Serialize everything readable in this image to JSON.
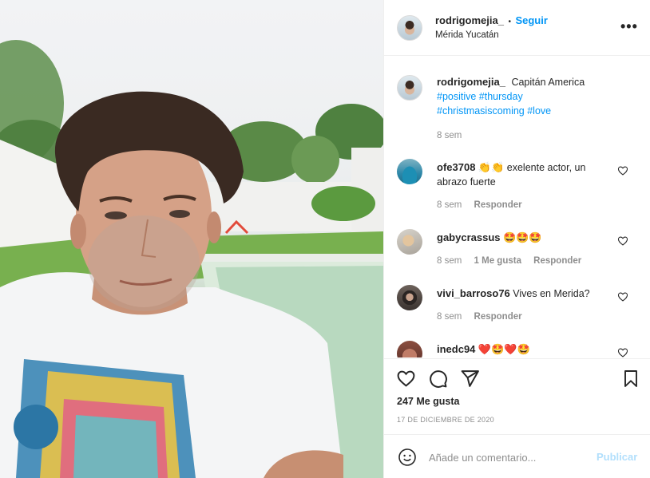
{
  "post": {
    "username": "rodrigomejia_",
    "follow_label": "Seguir",
    "dot": "•",
    "location": "Mérida Yucatán",
    "more_label": "•••"
  },
  "caption": {
    "username": "rodrigomejia_",
    "text": "Capitán America",
    "hashtags_line1": "#positive #thursday",
    "hashtags_line2": "#christmasiscoming #love",
    "time": "8 sem"
  },
  "comments": [
    {
      "username": "ofe3708",
      "emoji": "👏👏",
      "text": "exelente actor, un abrazo fuerte",
      "time": "8 sem",
      "reply_label": "Responder",
      "likes_label": ""
    },
    {
      "username": "gabycrassus",
      "emoji": "🤩🤩🤩",
      "text": "",
      "time": "8 sem",
      "likes_label": "1 Me gusta",
      "reply_label": "Responder"
    },
    {
      "username": "vivi_barroso76",
      "emoji": "",
      "text": "Vives en Merida?",
      "time": "8 sem",
      "reply_label": "Responder",
      "likes_label": ""
    },
    {
      "username": "inedc94",
      "emoji": "❤️🤩❤️🤩",
      "text": "",
      "time": "",
      "reply_label": "",
      "likes_label": ""
    }
  ],
  "footer": {
    "likes": "247 Me gusta",
    "date": "17 DE DICIEMBRE DE 2020",
    "comment_placeholder": "Añade un comentario...",
    "publish_label": "Publicar"
  },
  "colors": {
    "accent": "#0095f6",
    "publish_disabled": "#b2dffc",
    "heart_red": "#ed4956"
  }
}
